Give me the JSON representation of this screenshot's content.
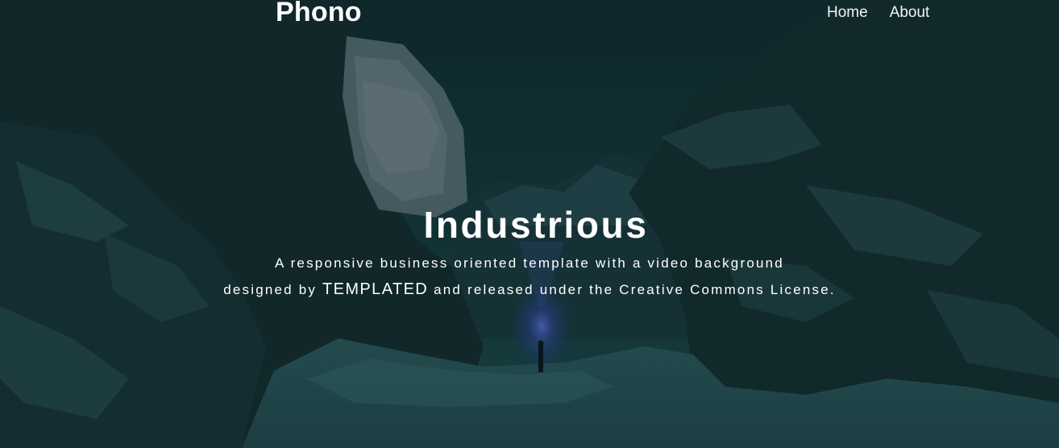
{
  "site": {
    "logo": "Phono"
  },
  "nav": {
    "items": [
      {
        "label": "Home"
      },
      {
        "label": "About"
      }
    ]
  },
  "hero": {
    "title": "Industrious",
    "line1": "A responsive business oriented template with a video background",
    "line2_prefix": "designed by ",
    "line2_brand": "TEMPLATED",
    "line2_suffix": " and released under the Creative Commons License."
  },
  "colors": {
    "text": "#ffffff",
    "background_tint": "#0f2226",
    "lamp_glow": "#4a5bd6"
  }
}
